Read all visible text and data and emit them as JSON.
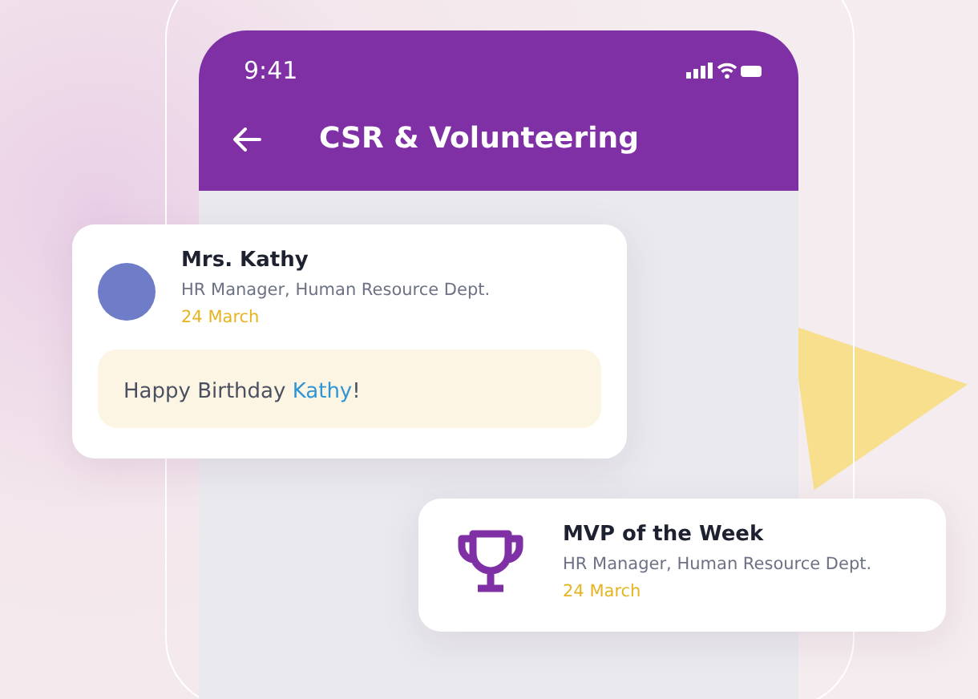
{
  "status_bar": {
    "time": "9:41"
  },
  "header": {
    "title": "CSR & Volunteering"
  },
  "cards": [
    {
      "kind": "post",
      "name": "Mrs. Kathy",
      "subtitle": "HR Manager, Human Resource Dept.",
      "date": "24 March",
      "message": {
        "text": "Happy Birthday ",
        "mention": "Kathy",
        "after": "!"
      }
    },
    {
      "kind": "award",
      "name": "MVP of the Week",
      "subtitle": "HR Manager, Human Resource Dept.",
      "date": "24 March"
    }
  ]
}
